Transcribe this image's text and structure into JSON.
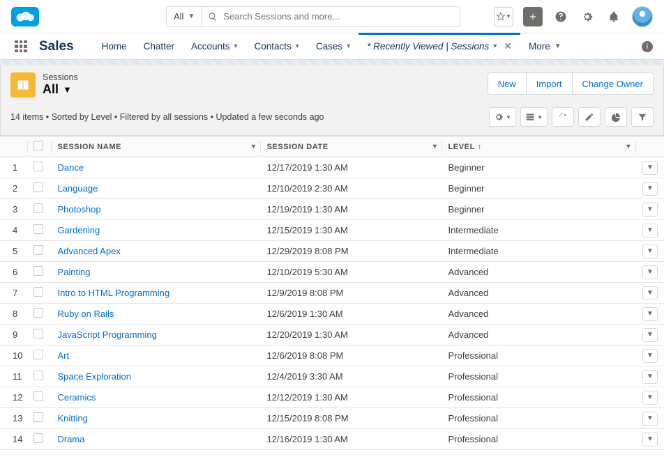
{
  "header": {
    "scope_label": "All",
    "search_placeholder": "Search Sessions and more..."
  },
  "nav": {
    "app_name": "Sales",
    "items": [
      {
        "label": "Home",
        "hasMenu": false
      },
      {
        "label": "Chatter",
        "hasMenu": false
      },
      {
        "label": "Accounts",
        "hasMenu": true
      },
      {
        "label": "Contacts",
        "hasMenu": true
      },
      {
        "label": "Cases",
        "hasMenu": true
      }
    ],
    "active_tab": "* Recently Viewed | Sessions",
    "more_label": "More"
  },
  "list": {
    "object_label": "Sessions",
    "view_name": "All",
    "actions": {
      "new": "New",
      "import": "Import",
      "change_owner": "Change Owner"
    },
    "meta": "14 items • Sorted by Level • Filtered by all sessions • Updated a few seconds ago"
  },
  "columns": {
    "session_name": "SESSION NAME",
    "session_date": "SESSION DATE",
    "level": "LEVEL"
  },
  "rows": [
    {
      "n": "1",
      "name": "Dance",
      "date": "12/17/2019 1:30 AM",
      "level": "Beginner"
    },
    {
      "n": "2",
      "name": "Language",
      "date": "12/10/2019 2:30 AM",
      "level": "Beginner"
    },
    {
      "n": "3",
      "name": "Photoshop",
      "date": "12/19/2019 1:30 AM",
      "level": "Beginner"
    },
    {
      "n": "4",
      "name": "Gardening",
      "date": "12/15/2019 1:30 AM",
      "level": "Intermediate"
    },
    {
      "n": "5",
      "name": "Advanced Apex",
      "date": "12/29/2019 8:08 PM",
      "level": "Intermediate"
    },
    {
      "n": "6",
      "name": "Painting",
      "date": "12/10/2019 5:30 AM",
      "level": "Advanced"
    },
    {
      "n": "7",
      "name": "Intro to HTML Programming",
      "date": "12/9/2019 8:08 PM",
      "level": "Advanced"
    },
    {
      "n": "8",
      "name": "Ruby on Rails",
      "date": "12/6/2019 1:30 AM",
      "level": "Advanced"
    },
    {
      "n": "9",
      "name": "JavaScript Programming",
      "date": "12/20/2019 1:30 AM",
      "level": "Advanced"
    },
    {
      "n": "10",
      "name": "Art",
      "date": "12/6/2019 8:08 PM",
      "level": "Professional"
    },
    {
      "n": "11",
      "name": "Space Exploration",
      "date": "12/4/2019 3:30 AM",
      "level": "Professional"
    },
    {
      "n": "12",
      "name": "Ceramics",
      "date": "12/12/2019 1:30 AM",
      "level": "Professional"
    },
    {
      "n": "13",
      "name": "Knitting",
      "date": "12/15/2019 8:08 PM",
      "level": "Professional"
    },
    {
      "n": "14",
      "name": "Drama",
      "date": "12/16/2019 1:30 AM",
      "level": "Professional"
    }
  ]
}
